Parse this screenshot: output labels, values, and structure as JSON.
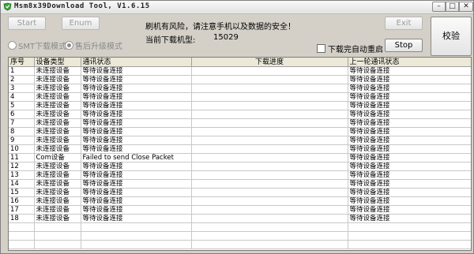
{
  "window": {
    "title": "Msm8x39Download Tool, V1.6.15",
    "buttons": {
      "minimize": "–",
      "maximize": "□",
      "close": "✕"
    }
  },
  "toolbar": {
    "start_label": "Start",
    "enum_label": "Enum",
    "exit_label": "Exit",
    "stop_label": "Stop",
    "verify_label": "校验"
  },
  "notice": "刷机有风险，请注意手机以及数据的安全！",
  "model": {
    "label": "当前下载机型:",
    "value": "15029"
  },
  "modes": [
    {
      "label": "SMT下载模式",
      "checked": false
    },
    {
      "label": "售后升级模式",
      "checked": true
    }
  ],
  "auto_restart": {
    "label": "下载完自动重启",
    "checked": false
  },
  "colors": {
    "icon": "#3aa53a"
  },
  "table": {
    "headers": [
      "序号",
      "设备类型",
      "通讯状态",
      "下载进度",
      "上一轮通讯状态"
    ],
    "rows": [
      [
        "1",
        "未连接设备",
        "等待设备连接",
        "",
        "等待设备连接"
      ],
      [
        "2",
        "未连接设备",
        "等待设备连接",
        "",
        "等待设备连接"
      ],
      [
        "3",
        "未连接设备",
        "等待设备连接",
        "",
        "等待设备连接"
      ],
      [
        "4",
        "未连接设备",
        "等待设备连接",
        "",
        "等待设备连接"
      ],
      [
        "5",
        "未连接设备",
        "等待设备连接",
        "",
        "等待设备连接"
      ],
      [
        "6",
        "未连接设备",
        "等待设备连接",
        "",
        "等待设备连接"
      ],
      [
        "7",
        "未连接设备",
        "等待设备连接",
        "",
        "等待设备连接"
      ],
      [
        "8",
        "未连接设备",
        "等待设备连接",
        "",
        "等待设备连接"
      ],
      [
        "9",
        "未连接设备",
        "等待设备连接",
        "",
        "等待设备连接"
      ],
      [
        "10",
        "未连接设备",
        "等待设备连接",
        "",
        "等待设备连接"
      ],
      [
        "11",
        "Com设备",
        "Failed to send Close Packet",
        "",
        "等待设备连接"
      ],
      [
        "12",
        "未连接设备",
        "等待设备连接",
        "",
        "等待设备连接"
      ],
      [
        "13",
        "未连接设备",
        "等待设备连接",
        "",
        "等待设备连接"
      ],
      [
        "14",
        "未连接设备",
        "等待设备连接",
        "",
        "等待设备连接"
      ],
      [
        "15",
        "未连接设备",
        "等待设备连接",
        "",
        "等待设备连接"
      ],
      [
        "16",
        "未连接设备",
        "等待设备连接",
        "",
        "等待设备连接"
      ],
      [
        "17",
        "未连接设备",
        "等待设备连接",
        "",
        "等待设备连接"
      ],
      [
        "18",
        "未连接设备",
        "等待设备连接",
        "",
        "等待设备连接"
      ]
    ]
  }
}
